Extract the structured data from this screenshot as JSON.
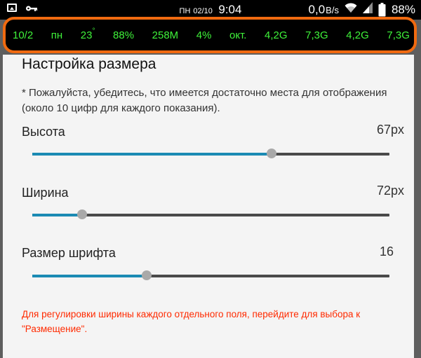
{
  "status_bar": {
    "day": "ПН",
    "date": "02/10",
    "time": "9:04",
    "net_speed": "0,0",
    "net_unit": "B/s",
    "battery": "88%",
    "icons": [
      "image-icon",
      "key-icon",
      "wifi-icon",
      "signal-icon",
      "battery-icon"
    ]
  },
  "overlay": {
    "items": [
      "10/2",
      "пн",
      "23",
      "88%",
      "258M",
      "4%",
      "окт.",
      "4,2G",
      "7,3G",
      "4,2G",
      "7,3G"
    ],
    "degree": "°",
    "text_color": "#3ff23a",
    "border_color": "#f06a10"
  },
  "settings": {
    "title": "Настройка размера",
    "note": "* Пожалуйста, убедитесь, что имеется достаточно места для отображения (около 10 цифр для каждого показания).",
    "sliders": [
      {
        "label": "Высота",
        "value": "67px",
        "level": 0.67
      },
      {
        "label": "Ширина",
        "value": "72px",
        "level": 0.14
      },
      {
        "label": "Размер шрифта",
        "value": "16",
        "level": 0.32
      }
    ],
    "warning": "Для регулировки ширины каждого отдельного поля, перейдите для выбора к \"Размещение\".",
    "accent_color": "#1b8ab3",
    "warning_color": "#ff2a00"
  }
}
